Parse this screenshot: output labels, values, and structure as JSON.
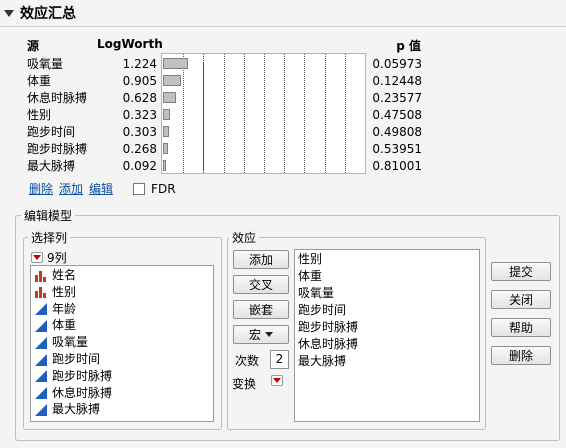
{
  "title": "效应汇总",
  "summary": {
    "headers": {
      "source": "源",
      "logworth": "LogWorth",
      "pvalue": "p 值"
    },
    "rows": [
      {
        "source": "吸氧量",
        "logworth": "1.224",
        "pvalue": "0.05973"
      },
      {
        "source": "体重",
        "logworth": "0.905",
        "pvalue": "0.12448"
      },
      {
        "source": "休息时脉搏",
        "logworth": "0.628",
        "pvalue": "0.23577"
      },
      {
        "source": "性别",
        "logworth": "0.323",
        "pvalue": "0.47508"
      },
      {
        "source": "跑步时间",
        "logworth": "0.303",
        "pvalue": "0.49808"
      },
      {
        "source": "跑步时脉搏",
        "logworth": "0.268",
        "pvalue": "0.53951"
      },
      {
        "source": "最大脉搏",
        "logworth": "0.092",
        "pvalue": "0.81001"
      }
    ],
    "links": {
      "delete": "删除",
      "add": "添加",
      "edit": "编辑"
    },
    "fdr_label": "FDR",
    "fdr_checked": false
  },
  "chart_data": {
    "type": "bar",
    "orientation": "horizontal",
    "categories": [
      "吸氧量",
      "体重",
      "休息时脉搏",
      "性别",
      "跑步时间",
      "跑步时脉搏",
      "最大脉搏"
    ],
    "values": [
      1.224,
      0.905,
      0.628,
      0.323,
      0.303,
      0.268,
      0.092
    ],
    "xlim": [
      0,
      10
    ],
    "reference_line": 2,
    "grid": true
  },
  "edit_model": {
    "legend": "编辑模型",
    "select_columns": {
      "legend": "选择列",
      "count_label": "9列",
      "columns": [
        {
          "name": "姓名",
          "icon": "nominal-icon"
        },
        {
          "name": "性别",
          "icon": "nominal-icon"
        },
        {
          "name": "年龄",
          "icon": "continuous-icon"
        },
        {
          "name": "体重",
          "icon": "continuous-icon"
        },
        {
          "name": "吸氧量",
          "icon": "continuous-icon"
        },
        {
          "name": "跑步时间",
          "icon": "continuous-icon"
        },
        {
          "name": "跑步时脉搏",
          "icon": "continuous-icon"
        },
        {
          "name": "休息时脉搏",
          "icon": "continuous-icon"
        },
        {
          "name": "最大脉搏",
          "icon": "continuous-icon"
        }
      ]
    },
    "effects": {
      "legend": "效应",
      "buttons": {
        "add": "添加",
        "cross": "交叉",
        "nest": "嵌套",
        "macro": "宏"
      },
      "degree_label": "次数",
      "degree_value": "2",
      "transform_label": "变换",
      "items": [
        "性别",
        "体重",
        "吸氧量",
        "跑步时间",
        "跑步时脉搏",
        "休息时脉搏",
        "最大脉搏"
      ]
    },
    "actions": {
      "submit": "提交",
      "close": "关闭",
      "help": "帮助",
      "remove": "删除"
    }
  },
  "colors": {
    "link": "#0b4ea2",
    "nominal_icon": "#c0392b",
    "continuous_icon": "#1f5fbf",
    "reference_line": "#1f4e9c"
  }
}
